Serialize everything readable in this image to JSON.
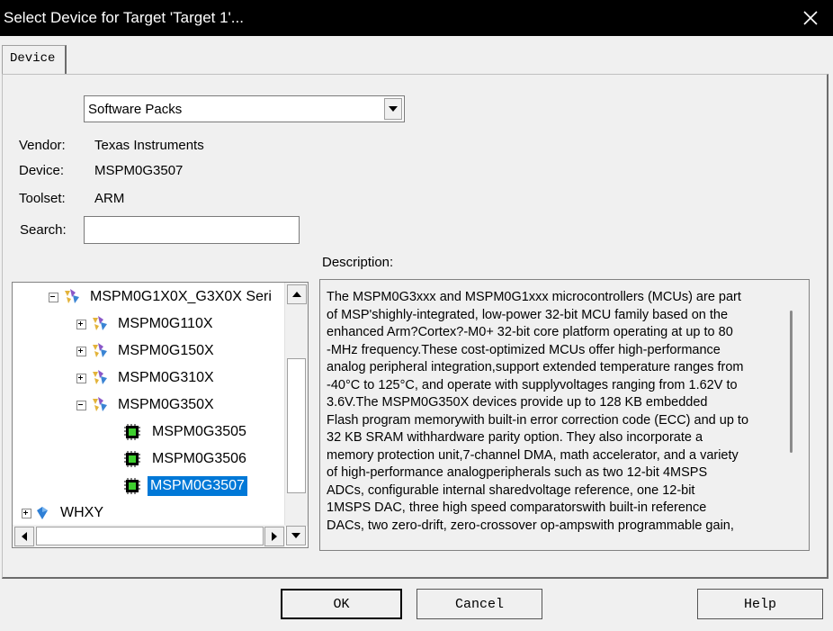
{
  "window": {
    "title": "Select Device for Target 'Target 1'..."
  },
  "tabs": [
    {
      "label": "Device"
    }
  ],
  "source_select": {
    "value": "Software Packs"
  },
  "info": {
    "vendor_label": "Vendor:",
    "vendor_value": "Texas Instruments",
    "device_label": "Device:",
    "device_value": "MSPM0G3507",
    "toolset_label": "Toolset:",
    "toolset_value": "ARM"
  },
  "search": {
    "label": "Search:",
    "value": ""
  },
  "description": {
    "label": "Description:",
    "lines": [
      "The MSPM0G3xxx and MSPM0G1xxx microcontrollers (MCUs) are part",
      "of MSP'shighly-integrated, low-power 32-bit MCU family based on the",
      "enhanced Arm?Cortex?-M0+ 32-bit core platform operating at up to 80",
      "-MHz frequency.These cost-optimized MCUs offer high-performance",
      "analog peripheral integration,support extended temperature ranges from",
      "-40°C to 125°C, and operate with supplyvoltages ranging from 1.62V to",
      "3.6V.The MSPM0G350X devices provide up to 128 KB embedded",
      "Flash program memorywith built-in error correction code (ECC) and up to",
      "32 KB SRAM withhardware parity option. They also incorporate a",
      "memory protection unit,7-channel DMA, math accelerator, and a variety",
      "of high-performance analogperipherals such as two 12-bit 4MSPS",
      "ADCs, configurable internal sharedvoltage reference, one 12-bit",
      "1MSPS DAC, three high speed comparatorswith built-in reference",
      "DACs, two zero-drift, zero-crossover op-ampswith programmable gain,"
    ]
  },
  "tree": {
    "nodes": [
      {
        "label": "MSPM0G1X0X_G3X0X Seri",
        "expander": "−",
        "icon": "family-icon"
      },
      {
        "label": "MSPM0G110X",
        "expander": "+",
        "icon": "subfamily-icon"
      },
      {
        "label": "MSPM0G150X",
        "expander": "+",
        "icon": "subfamily-icon"
      },
      {
        "label": "MSPM0G310X",
        "expander": "+",
        "icon": "subfamily-icon"
      },
      {
        "label": "MSPM0G350X",
        "expander": "−",
        "icon": "subfamily-icon"
      },
      {
        "label": "MSPM0G3505",
        "icon": "chip-icon"
      },
      {
        "label": "MSPM0G3506",
        "icon": "chip-icon"
      },
      {
        "label": "MSPM0G3507",
        "icon": "chip-icon",
        "selected": true
      },
      {
        "label": "WHXY",
        "expander": "+",
        "icon": "vendor-icon"
      }
    ]
  },
  "buttons": {
    "ok": "OK",
    "cancel": "Cancel",
    "help": "Help"
  },
  "colors": {
    "titlebar": "#000000",
    "selection": "#0078d7",
    "chip_green": "#3ecf2e"
  }
}
